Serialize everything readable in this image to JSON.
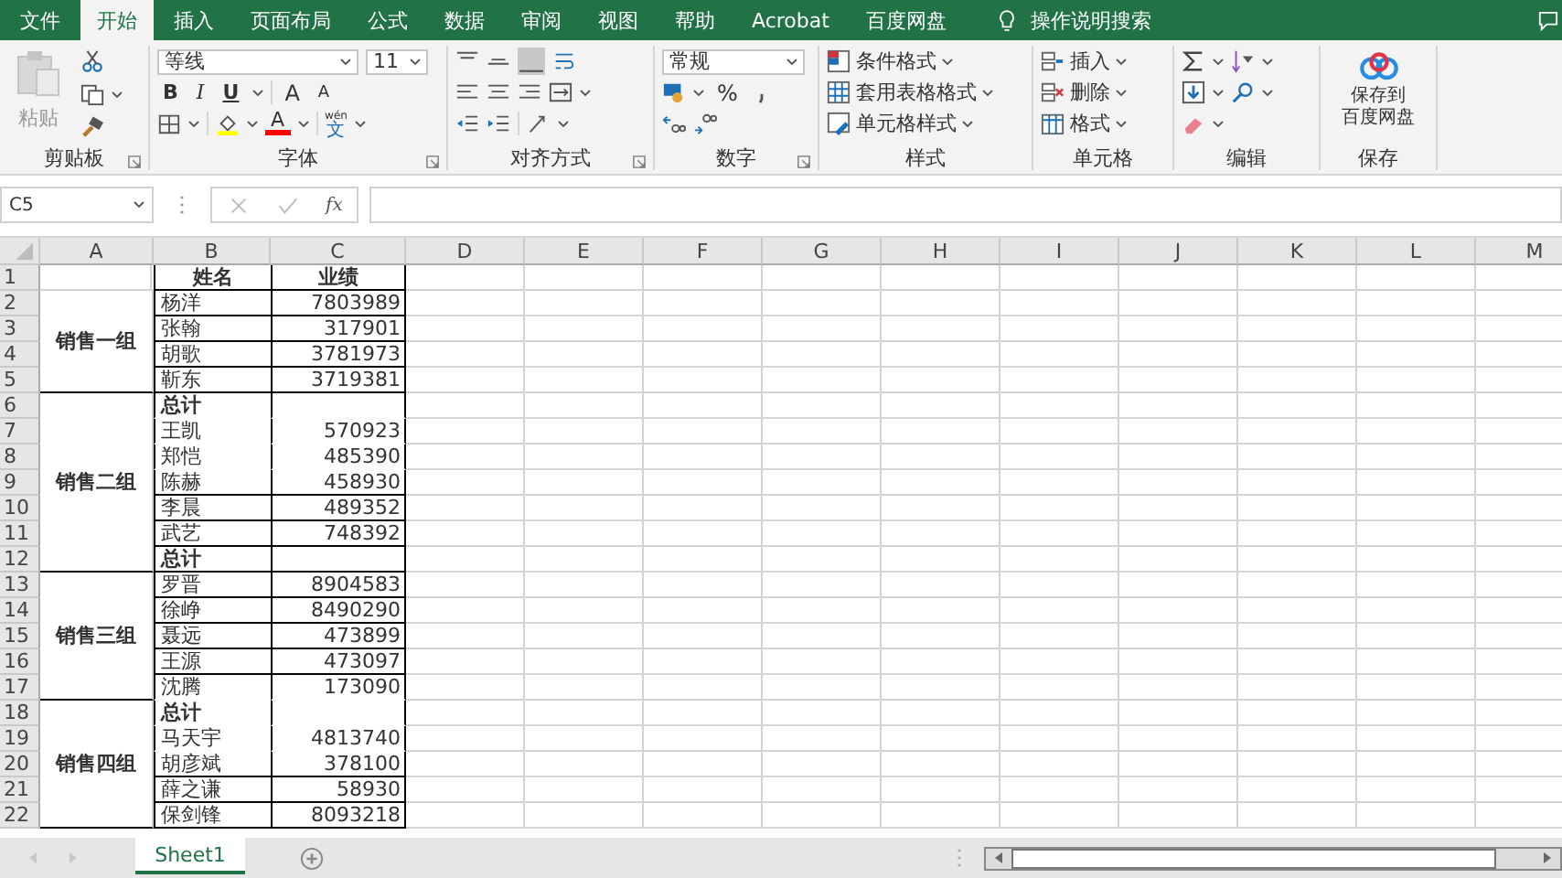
{
  "tabs": [
    {
      "label": "文件",
      "selected": false
    },
    {
      "label": "开始",
      "selected": true
    },
    {
      "label": "插入",
      "selected": false
    },
    {
      "label": "页面布局",
      "selected": false
    },
    {
      "label": "公式",
      "selected": false
    },
    {
      "label": "数据",
      "selected": false
    },
    {
      "label": "审阅",
      "selected": false
    },
    {
      "label": "视图",
      "selected": false
    },
    {
      "label": "帮助",
      "selected": false
    },
    {
      "label": "Acrobat",
      "selected": false
    },
    {
      "label": "百度网盘",
      "selected": false
    }
  ],
  "tell_me": "操作说明搜索",
  "clipboard": {
    "paste": "粘贴",
    "label": "剪贴板"
  },
  "font": {
    "name": "等线",
    "size": "11",
    "bold": "B",
    "italic": "I",
    "underline": "U",
    "grow": "A",
    "shrink": "A",
    "color_letter": "A",
    "phonetic_top": "wén",
    "phonetic_bottom": "文",
    "label": "字体"
  },
  "alignment": {
    "label": "对齐方式"
  },
  "number": {
    "format": "常规",
    "percent": "%",
    "label": "数字"
  },
  "styles": {
    "items": [
      "条件格式",
      "套用表格格式",
      "单元格样式"
    ],
    "label": "样式"
  },
  "cells": {
    "items": [
      "插入",
      "删除",
      "格式"
    ],
    "label": "单元格"
  },
  "editing": {
    "label": "编辑"
  },
  "save": {
    "button": [
      "保存到",
      "百度网盘"
    ],
    "label": "保存"
  },
  "formula_bar": {
    "name_box": "C5",
    "fx": "fx"
  },
  "sheet": {
    "columns": [
      "A",
      "B",
      "C",
      "D",
      "E",
      "F",
      "G",
      "H",
      "I",
      "J",
      "K",
      "L",
      "M"
    ],
    "blocks": [
      {
        "rows": [
          {
            "num": "1",
            "name": "姓名",
            "score": "业绩",
            "bordered": true,
            "kind": "header"
          }
        ]
      },
      {
        "group": "销售一组",
        "rows": [
          {
            "num": "2",
            "name": "杨洋",
            "score": "7803989",
            "bordered": true,
            "kind": "data"
          },
          {
            "num": "3",
            "name": "张翰",
            "score": "317901",
            "bordered": true,
            "kind": "data"
          },
          {
            "num": "4",
            "name": "胡歌",
            "score": "3781973",
            "bordered": true,
            "kind": "data"
          },
          {
            "num": "5",
            "name": "靳东",
            "score": "3719381",
            "bordered": true,
            "kind": "data"
          }
        ]
      },
      {
        "group": "销售二组",
        "rows": [
          {
            "num": "6",
            "name": "总计",
            "bordered": false,
            "kind": "total"
          },
          {
            "num": "7",
            "name": "王凯",
            "score": "570923",
            "bordered": false,
            "kind": "data"
          },
          {
            "num": "8",
            "name": "郑恺",
            "score": "485390",
            "bordered": false,
            "kind": "data"
          },
          {
            "num": "9",
            "name": "陈赫",
            "score": "458930",
            "bordered": true,
            "kind": "data"
          },
          {
            "num": "10",
            "name": "李晨",
            "score": "489352",
            "bordered": true,
            "kind": "data"
          },
          {
            "num": "11",
            "name": "武艺",
            "score": "748392",
            "bordered": true,
            "kind": "data"
          },
          {
            "num": "12",
            "name": "总计",
            "bordered": true,
            "kind": "total"
          }
        ]
      },
      {
        "group": "销售三组",
        "rows": [
          {
            "num": "13",
            "name": "罗晋",
            "score": "8904583",
            "bordered": true,
            "kind": "data"
          },
          {
            "num": "14",
            "name": "徐峥",
            "score": "8490290",
            "bordered": true,
            "kind": "data"
          },
          {
            "num": "15",
            "name": "聂远",
            "score": "473899",
            "bordered": true,
            "kind": "data"
          },
          {
            "num": "16",
            "name": "王源",
            "score": "473097",
            "bordered": true,
            "kind": "data"
          },
          {
            "num": "17",
            "name": "沈腾",
            "score": "173090",
            "bordered": false,
            "kind": "data"
          }
        ]
      },
      {
        "group": "销售四组",
        "rows": [
          {
            "num": "18",
            "name": "总计",
            "bordered": false,
            "kind": "total"
          },
          {
            "num": "19",
            "name": "马天宇",
            "score": "4813740",
            "bordered": false,
            "kind": "data"
          },
          {
            "num": "20",
            "name": "胡彦斌",
            "score": "378100",
            "bordered": true,
            "kind": "data"
          },
          {
            "num": "21",
            "name": "薛之谦",
            "score": "58930",
            "bordered": true,
            "kind": "data"
          },
          {
            "num": "22",
            "name": "保剑锋",
            "score": "8093218",
            "bordered": true,
            "kind": "data"
          }
        ]
      }
    ]
  },
  "sheet_tabs": [
    {
      "label": "Sheet1",
      "selected": true
    }
  ]
}
